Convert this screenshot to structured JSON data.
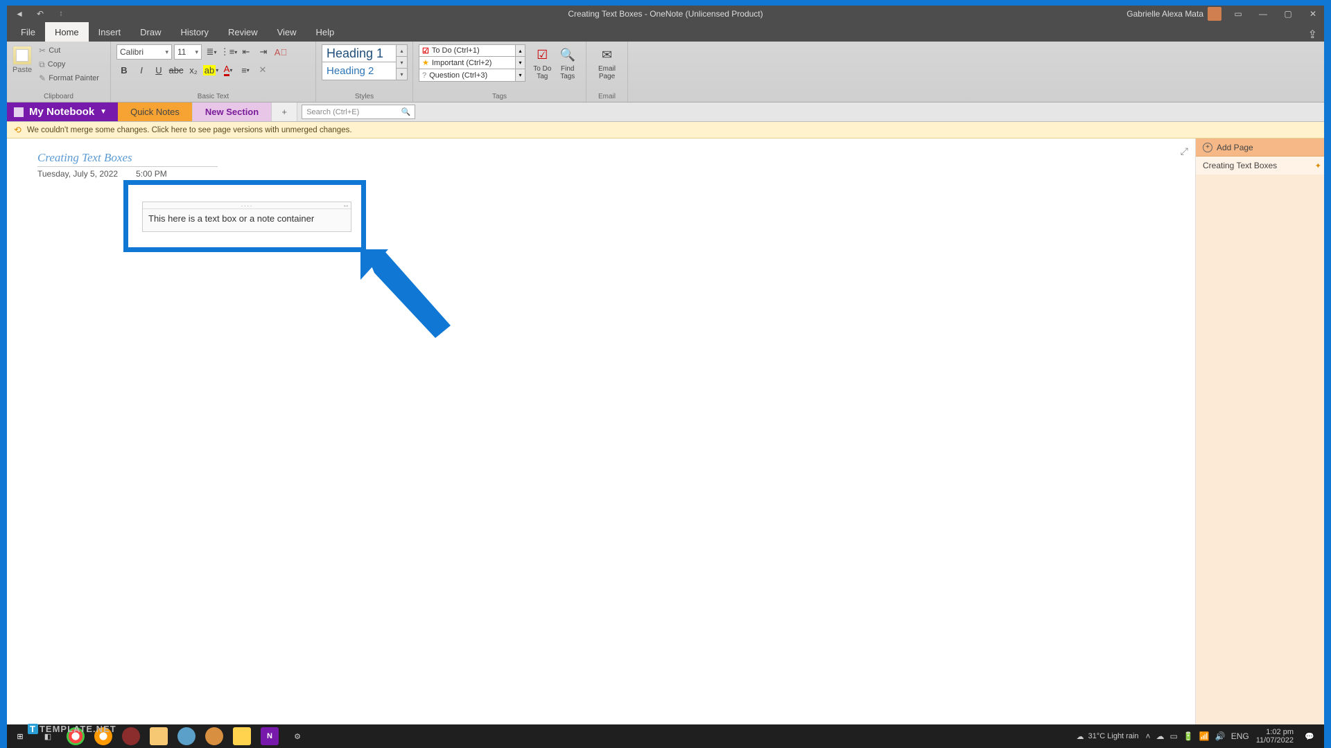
{
  "titlebar": {
    "title": "Creating Text Boxes  -  OneNote (Unlicensed Product)",
    "user": "Gabrielle Alexa Mata"
  },
  "menutabs": [
    "File",
    "Home",
    "Insert",
    "Draw",
    "History",
    "Review",
    "View",
    "Help"
  ],
  "ribbon": {
    "clipboard": {
      "paste": "Paste",
      "cut": "Cut",
      "copy": "Copy",
      "painter": "Format Painter",
      "label": "Clipboard"
    },
    "basictext": {
      "font": "Calibri",
      "size": "11",
      "label": "Basic Text"
    },
    "styles": {
      "h1": "Heading 1",
      "h2": "Heading 2",
      "label": "Styles"
    },
    "tags": {
      "todo": "To Do (Ctrl+1)",
      "imp": "Important (Ctrl+2)",
      "q": "Question (Ctrl+3)",
      "todo_btn": "To Do\nTag",
      "find": "Find\nTags",
      "label": "Tags"
    },
    "email": {
      "btn": "Email\nPage",
      "label": "Email"
    }
  },
  "nbkbar": {
    "notebook": "My Notebook",
    "tab_quick": "Quick Notes",
    "tab_new": "New Section",
    "search_ph": "Search (Ctrl+E)"
  },
  "warn": "We couldn't merge some changes. Click here to see page versions with unmerged changes.",
  "page": {
    "title": "Creating Text Boxes",
    "date": "Tuesday, July 5, 2022",
    "time": "5:00 PM",
    "textbox": "This here is a text box or a note container"
  },
  "sidep": {
    "add": "Add Page",
    "p1": "Creating Text Boxes"
  },
  "taskbar": {
    "weather": "31°C  Light rain",
    "lang": "ENG",
    "time": "1:02 pm",
    "date": "11/07/2022"
  },
  "watermark": "TEMPLATE.NET"
}
